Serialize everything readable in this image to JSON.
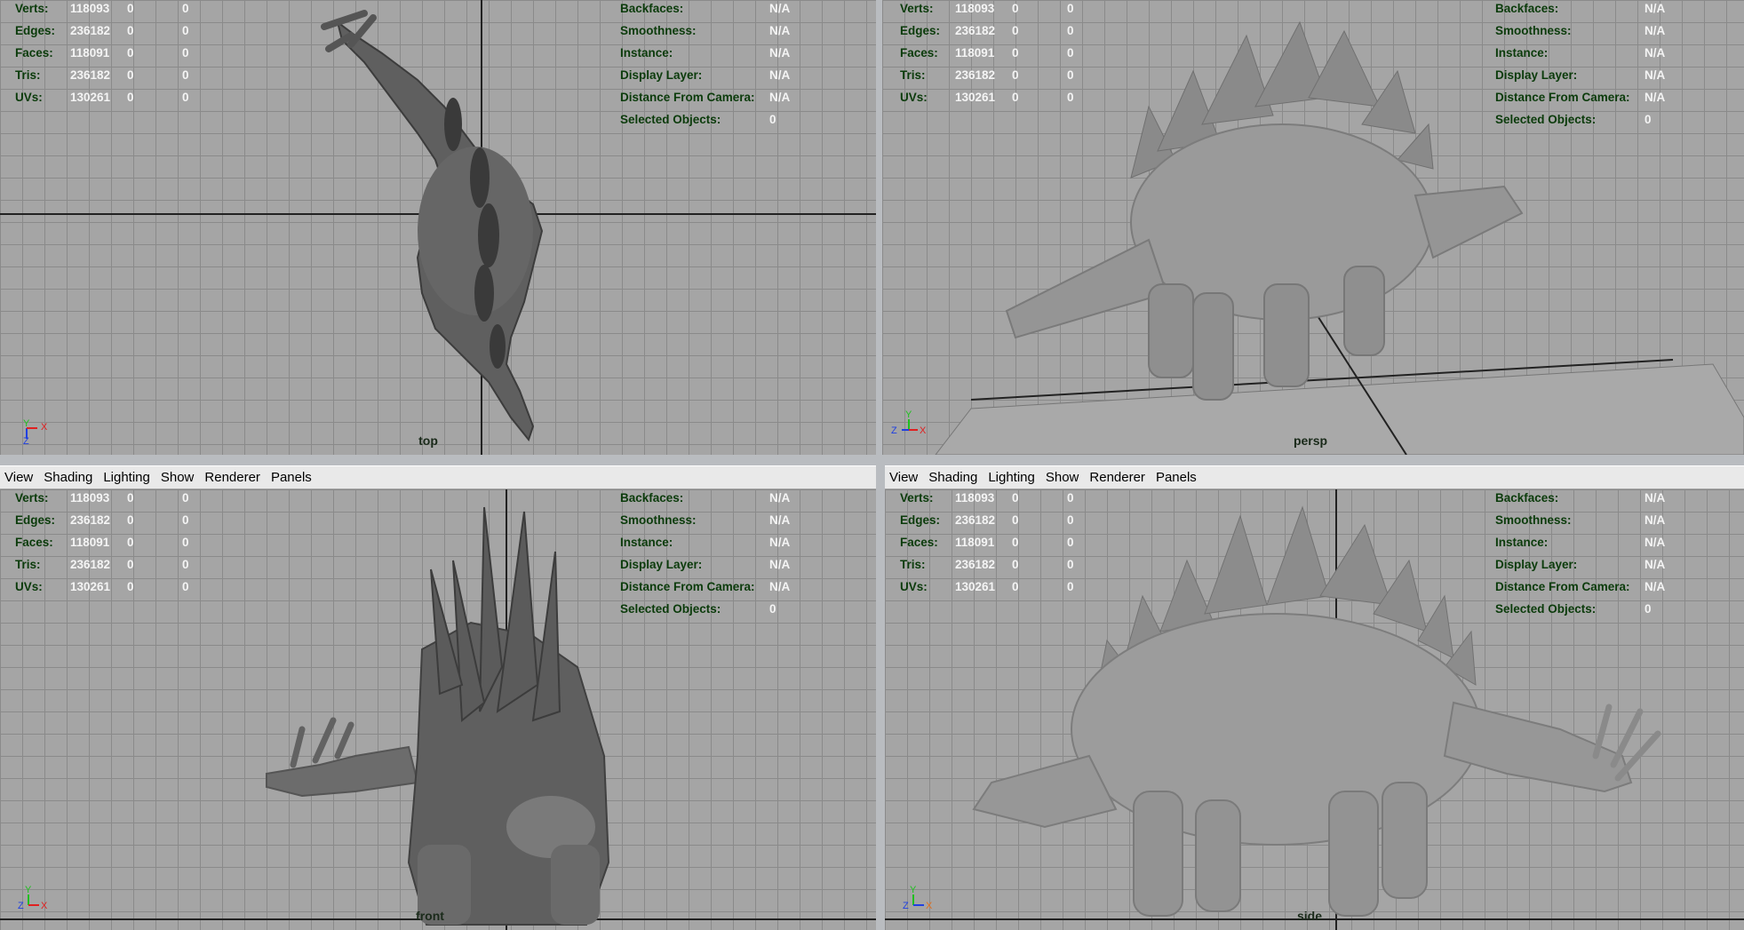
{
  "menu": [
    "View",
    "Shading",
    "Lighting",
    "Show",
    "Renderer",
    "Panels"
  ],
  "hud_stats": {
    "rows": [
      {
        "label": "Verts:",
        "v1": "118093",
        "v2": "0",
        "v3": "0"
      },
      {
        "label": "Edges:",
        "v1": "236182",
        "v2": "0",
        "v3": "0"
      },
      {
        "label": "Faces:",
        "v1": "118091",
        "v2": "0",
        "v3": "0"
      },
      {
        "label": "Tris:",
        "v1": "236182",
        "v2": "0",
        "v3": "0"
      },
      {
        "label": "UVs:",
        "v1": "130261",
        "v2": "0",
        "v3": "0"
      }
    ]
  },
  "hud_info": {
    "rows": [
      {
        "label": "Backfaces:",
        "value": "N/A"
      },
      {
        "label": "Smoothness:",
        "value": "N/A"
      },
      {
        "label": "Instance:",
        "value": "N/A"
      },
      {
        "label": "Display Layer:",
        "value": "N/A"
      },
      {
        "label": "Distance From Camera:",
        "value": "N/A"
      },
      {
        "label": "Selected Objects:",
        "value": "0"
      }
    ]
  },
  "viewports": {
    "top": {
      "camera": "top"
    },
    "persp": {
      "camera": "persp"
    },
    "front": {
      "camera": "front"
    },
    "side": {
      "camera": "side"
    }
  },
  "axes": {
    "x": "X",
    "y": "Y",
    "z": "Z"
  },
  "colors": {
    "axis_x": "#e02020",
    "axis_y": "#20c020",
    "axis_z": "#2040e0",
    "viewport_bg": "#a5a5a5",
    "grid": "#8a8a8a"
  }
}
